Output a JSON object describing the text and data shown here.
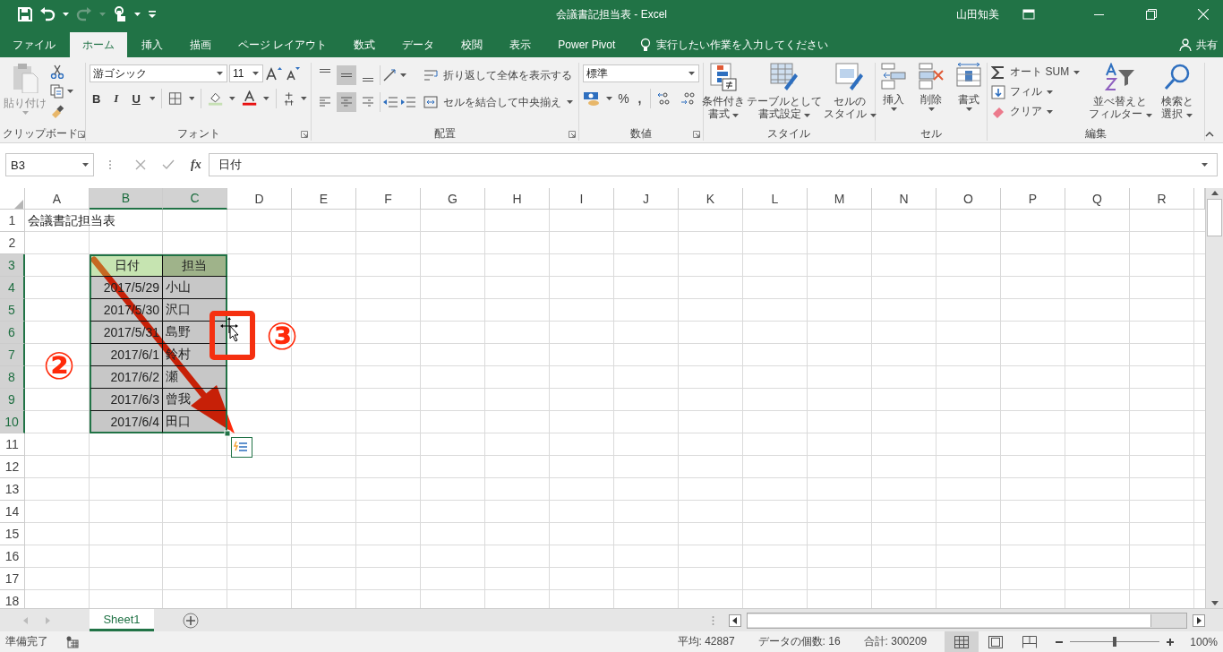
{
  "window": {
    "title": "会議書記担当表 - Excel",
    "user": "山田知美"
  },
  "quick_access": [
    {
      "kind": "save",
      "disabled": false
    },
    {
      "kind": "undo",
      "disabled": false
    },
    {
      "kind": "redo",
      "disabled": true
    },
    {
      "kind": "touch",
      "disabled": false
    }
  ],
  "tabs": [
    {
      "label": "ファイル",
      "selected": false
    },
    {
      "label": "ホーム",
      "selected": true
    },
    {
      "label": "挿入",
      "selected": false
    },
    {
      "label": "描画",
      "selected": false
    },
    {
      "label": "ページ レイアウト",
      "selected": false
    },
    {
      "label": "数式",
      "selected": false
    },
    {
      "label": "データ",
      "selected": false
    },
    {
      "label": "校閲",
      "selected": false
    },
    {
      "label": "表示",
      "selected": false
    },
    {
      "label": "Power Pivot",
      "selected": false
    }
  ],
  "tell_me": {
    "placeholder": "実行したい作業を入力してください"
  },
  "share": "共有",
  "ribbon": {
    "clipboard": {
      "paste": "貼り付け",
      "label": "クリップボード"
    },
    "font": {
      "name": "游ゴシック",
      "size": "11",
      "bold": "B",
      "italic": "I",
      "underline": "U",
      "label": "フォント"
    },
    "alignment": {
      "vertical": [
        {
          "selected": false
        },
        {
          "selected": true
        },
        {
          "selected": false
        }
      ],
      "horizontal": [
        {
          "selected": false
        },
        {
          "selected": true
        },
        {
          "selected": false
        }
      ],
      "wrap_text": "折り返して全体を表示する",
      "merge": "セルを結合して中央揃え",
      "label": "配置"
    },
    "number": {
      "format": "標準",
      "percent": "%",
      "comma": ",",
      "label": "数値"
    },
    "styles": {
      "buttons": [
        {
          "lines": [
            "条件付き",
            "書式"
          ]
        },
        {
          "lines": [
            "テーブルとして",
            "書式設定"
          ]
        },
        {
          "lines": [
            "セルの",
            "スタイル"
          ]
        }
      ],
      "label": "スタイル"
    },
    "cells": {
      "buttons": [
        "挿入",
        "削除",
        "書式"
      ],
      "label": "セル"
    },
    "editing": {
      "small": [
        "オート SUM",
        "フィル",
        "クリア"
      ],
      "large": [
        {
          "lines": [
            "並べ替えと",
            "フィルター"
          ]
        },
        {
          "lines": [
            "検索と",
            "選択"
          ]
        }
      ],
      "label": "編集"
    }
  },
  "formula_bar": {
    "name_box": "B3",
    "fx": "fx",
    "value": "日付"
  },
  "sheet": {
    "columns": [
      {
        "label": "A",
        "selected": false
      },
      {
        "label": "B",
        "selected": true
      },
      {
        "label": "C",
        "selected": true
      },
      {
        "label": "D",
        "selected": false
      },
      {
        "label": "E",
        "selected": false
      },
      {
        "label": "F",
        "selected": false
      },
      {
        "label": "G",
        "selected": false
      },
      {
        "label": "H",
        "selected": false
      },
      {
        "label": "I",
        "selected": false
      },
      {
        "label": "J",
        "selected": false
      },
      {
        "label": "K",
        "selected": false
      },
      {
        "label": "L",
        "selected": false
      },
      {
        "label": "M",
        "selected": false
      },
      {
        "label": "N",
        "selected": false
      },
      {
        "label": "O",
        "selected": false
      },
      {
        "label": "P",
        "selected": false
      },
      {
        "label": "Q",
        "selected": false
      },
      {
        "label": "R",
        "selected": false
      }
    ],
    "rows": [
      {
        "label": "1",
        "selected": false
      },
      {
        "label": "2",
        "selected": false
      },
      {
        "label": "3",
        "selected": true
      },
      {
        "label": "4",
        "selected": true
      },
      {
        "label": "5",
        "selected": true
      },
      {
        "label": "6",
        "selected": true
      },
      {
        "label": "7",
        "selected": true
      },
      {
        "label": "8",
        "selected": true
      },
      {
        "label": "9",
        "selected": true
      },
      {
        "label": "10",
        "selected": true
      },
      {
        "label": "11",
        "selected": false
      },
      {
        "label": "12",
        "selected": false
      },
      {
        "label": "13",
        "selected": false
      },
      {
        "label": "14",
        "selected": false
      },
      {
        "label": "15",
        "selected": false
      },
      {
        "label": "16",
        "selected": false
      },
      {
        "label": "17",
        "selected": false
      },
      {
        "label": "18",
        "selected": false
      }
    ],
    "title_cell": "会議書記担当表",
    "table": {
      "header": [
        "日付",
        "担当"
      ],
      "rows": [
        [
          "2017/5/29",
          "小山"
        ],
        [
          "2017/5/30",
          "沢口"
        ],
        [
          "2017/5/31",
          "島野"
        ],
        [
          "2017/6/1",
          "鈴村"
        ],
        [
          "2017/6/2",
          "瀬"
        ],
        [
          "2017/6/3",
          "曾我"
        ],
        [
          "2017/6/4",
          "田口"
        ]
      ]
    },
    "callouts": [
      "②",
      "③"
    ]
  },
  "sheet_tabs": [
    {
      "label": "Sheet1",
      "selected": true
    }
  ],
  "status": {
    "mode": "準備完了",
    "stats": [
      "平均: 42887",
      "データの個数: 16",
      "合計: 300209"
    ],
    "views": [
      {
        "selected": true
      },
      {
        "selected": false
      },
      {
        "selected": false
      }
    ],
    "zoom": {
      "level": 0.5,
      "reading": "100%"
    }
  }
}
